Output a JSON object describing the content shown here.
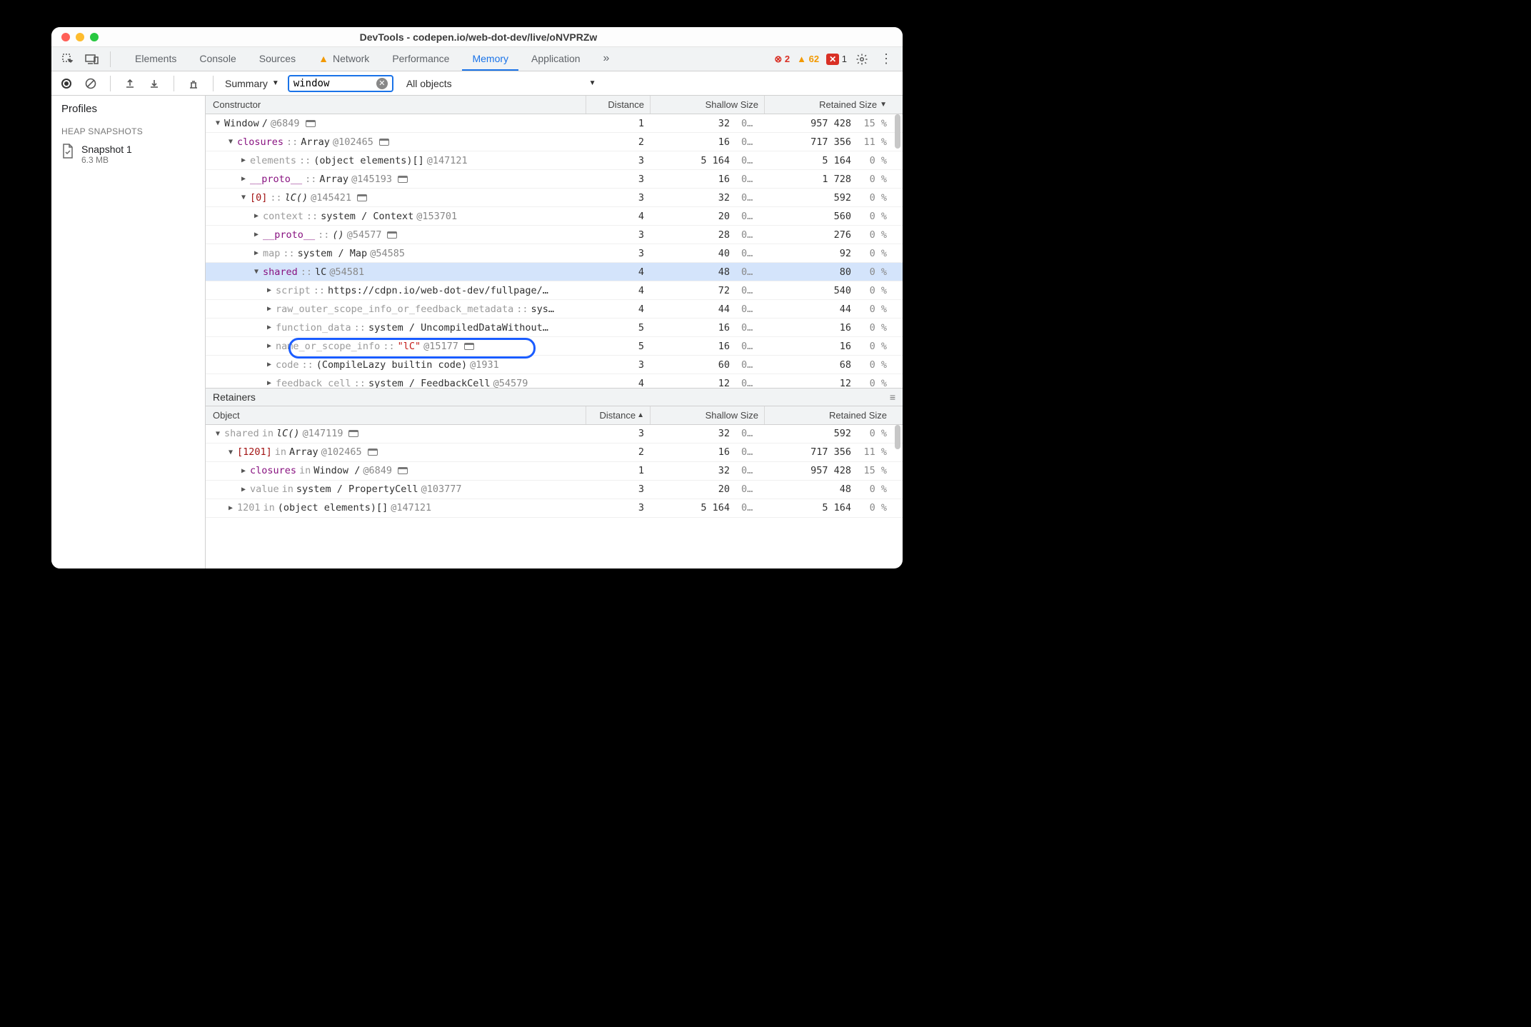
{
  "title": "DevTools - codepen.io/web-dot-dev/live/oNVPRZw",
  "tabs": [
    "Elements",
    "Console",
    "Sources",
    "Network",
    "Performance",
    "Memory",
    "Application"
  ],
  "active_tab": "Memory",
  "overflow_glyph": "»",
  "counters": {
    "errors": 2,
    "warnings": 62,
    "red": 1
  },
  "toolbar": {
    "summary_label": "Summary",
    "filter_value": "window",
    "all_objects_label": "All objects"
  },
  "sidebar": {
    "profiles_label": "Profiles",
    "section_label": "HEAP SNAPSHOTS",
    "snapshot": {
      "name": "Snapshot 1",
      "size": "6.3 MB"
    }
  },
  "headers": {
    "constructor": "Constructor",
    "distance": "Distance",
    "shallow": "Shallow Size",
    "retained": "Retained Size",
    "object": "Object"
  },
  "constructor_rows": [
    {
      "indent": 0,
      "disc": "▼",
      "segments": [
        {
          "t": "Window",
          "c": ""
        },
        {
          "t": " /   ",
          "c": ""
        },
        {
          "t": "@6849",
          "c": "at"
        }
      ],
      "win": true,
      "dist": "1",
      "sh": "32",
      "shp": "0 %",
      "ret": "957 428",
      "retp": "15 %"
    },
    {
      "indent": 1,
      "disc": "▼",
      "segments": [
        {
          "t": "closures",
          "c": "k-purple"
        },
        {
          "t": " :: ",
          "c": "k-grey"
        },
        {
          "t": "Array ",
          "c": ""
        },
        {
          "t": "@102465",
          "c": "at"
        }
      ],
      "win": true,
      "dist": "2",
      "sh": "16",
      "shp": "0 %",
      "ret": "717 356",
      "retp": "11 %"
    },
    {
      "indent": 2,
      "disc": "▶",
      "segments": [
        {
          "t": "elements",
          "c": "k-grey"
        },
        {
          "t": " :: ",
          "c": "k-grey"
        },
        {
          "t": "(object elements)[] ",
          "c": ""
        },
        {
          "t": "@147121",
          "c": "at"
        }
      ],
      "dist": "3",
      "sh": "5 164",
      "shp": "0 %",
      "ret": "5 164",
      "retp": "0 %"
    },
    {
      "indent": 2,
      "disc": "▶",
      "segments": [
        {
          "t": "__proto__",
          "c": "k-purple"
        },
        {
          "t": " :: ",
          "c": "k-grey"
        },
        {
          "t": "Array ",
          "c": ""
        },
        {
          "t": "@145193",
          "c": "at"
        }
      ],
      "win": true,
      "dist": "3",
      "sh": "16",
      "shp": "0 %",
      "ret": "1 728",
      "retp": "0 %"
    },
    {
      "indent": 2,
      "disc": "▼",
      "segments": [
        {
          "t": "[0]",
          "c": "k-darkred"
        },
        {
          "t": " :: ",
          "c": "k-grey"
        },
        {
          "t": "lC() ",
          "c": "italic"
        },
        {
          "t": "@145421",
          "c": "at"
        }
      ],
      "win": true,
      "dist": "3",
      "sh": "32",
      "shp": "0 %",
      "ret": "592",
      "retp": "0 %"
    },
    {
      "indent": 3,
      "disc": "▶",
      "segments": [
        {
          "t": "context",
          "c": "k-grey"
        },
        {
          "t": " :: ",
          "c": "k-grey"
        },
        {
          "t": "system / Context ",
          "c": ""
        },
        {
          "t": "@153701",
          "c": "at"
        }
      ],
      "dist": "4",
      "sh": "20",
      "shp": "0 %",
      "ret": "560",
      "retp": "0 %"
    },
    {
      "indent": 3,
      "disc": "▶",
      "segments": [
        {
          "t": "__proto__",
          "c": "k-purple"
        },
        {
          "t": " :: ",
          "c": "k-grey"
        },
        {
          "t": "() ",
          "c": "italic"
        },
        {
          "t": "@54577",
          "c": "at"
        }
      ],
      "win": true,
      "dist": "3",
      "sh": "28",
      "shp": "0 %",
      "ret": "276",
      "retp": "0 %"
    },
    {
      "indent": 3,
      "disc": "▶",
      "segments": [
        {
          "t": "map",
          "c": "k-grey"
        },
        {
          "t": " :: ",
          "c": "k-grey"
        },
        {
          "t": "system / Map ",
          "c": ""
        },
        {
          "t": "@54585",
          "c": "at"
        }
      ],
      "dist": "3",
      "sh": "40",
      "shp": "0 %",
      "ret": "92",
      "retp": "0 %"
    },
    {
      "indent": 3,
      "disc": "▼",
      "segments": [
        {
          "t": "shared",
          "c": "k-purple"
        },
        {
          "t": " :: ",
          "c": "k-grey"
        },
        {
          "t": "lC ",
          "c": ""
        },
        {
          "t": "@54581",
          "c": "at"
        }
      ],
      "sel": true,
      "dist": "4",
      "sh": "48",
      "shp": "0 %",
      "ret": "80",
      "retp": "0 %"
    },
    {
      "indent": 4,
      "disc": "▶",
      "segments": [
        {
          "t": "script",
          "c": "k-grey"
        },
        {
          "t": " :: ",
          "c": "k-grey"
        },
        {
          "t": "https://cdpn.io/web-dot-dev/fullpage/…",
          "c": ""
        }
      ],
      "dist": "4",
      "sh": "72",
      "shp": "0 %",
      "ret": "540",
      "retp": "0 %"
    },
    {
      "indent": 4,
      "disc": "▶",
      "segments": [
        {
          "t": "raw_outer_scope_info_or_feedback_metadata",
          "c": "k-grey"
        },
        {
          "t": " :: ",
          "c": "k-grey"
        },
        {
          "t": "sys…",
          "c": ""
        }
      ],
      "dist": "4",
      "sh": "44",
      "shp": "0 %",
      "ret": "44",
      "retp": "0 %"
    },
    {
      "indent": 4,
      "disc": "▶",
      "segments": [
        {
          "t": "function_data",
          "c": "k-grey"
        },
        {
          "t": " :: ",
          "c": "k-grey"
        },
        {
          "t": "system / UncompiledDataWithout…",
          "c": ""
        }
      ],
      "dist": "5",
      "sh": "16",
      "shp": "0 %",
      "ret": "16",
      "retp": "0 %"
    },
    {
      "indent": 4,
      "disc": "▶",
      "segments": [
        {
          "t": "name_or_scope_info",
          "c": "k-grey"
        },
        {
          "t": " :: ",
          "c": "k-grey"
        },
        {
          "t": "\"lC\"",
          "c": "k-red"
        },
        {
          "t": " @15177",
          "c": "at"
        }
      ],
      "win": true,
      "ring": true,
      "dist": "5",
      "sh": "16",
      "shp": "0 %",
      "ret": "16",
      "retp": "0 %"
    },
    {
      "indent": 4,
      "disc": "▶",
      "segments": [
        {
          "t": "code",
          "c": "k-grey"
        },
        {
          "t": " :: ",
          "c": "k-grey"
        },
        {
          "t": "(CompileLazy builtin code) ",
          "c": ""
        },
        {
          "t": "@1931",
          "c": "at"
        }
      ],
      "dist": "3",
      "sh": "60",
      "shp": "0 %",
      "ret": "68",
      "retp": "0 %"
    },
    {
      "indent": 4,
      "disc": "▶",
      "segments": [
        {
          "t": "feedback_cell",
          "c": "k-grey"
        },
        {
          "t": " :: ",
          "c": "k-grey"
        },
        {
          "t": "system / FeedbackCell ",
          "c": ""
        },
        {
          "t": "@54579",
          "c": "at"
        }
      ],
      "dist": "4",
      "sh": "12",
      "shp": "0 %",
      "ret": "12",
      "retp": "0 %"
    }
  ],
  "retainers_label": "Retainers",
  "retainer_rows": [
    {
      "indent": 0,
      "disc": "▼",
      "segments": [
        {
          "t": "shared",
          "c": "k-grey"
        },
        {
          "t": " in ",
          "c": "k-grey"
        },
        {
          "t": "lC() ",
          "c": "italic"
        },
        {
          "t": "@147119",
          "c": "at"
        }
      ],
      "win": true,
      "dist": "3",
      "sh": "32",
      "shp": "0 %",
      "ret": "592",
      "retp": "0 %"
    },
    {
      "indent": 1,
      "disc": "▼",
      "segments": [
        {
          "t": "[1201]",
          "c": "k-darkred"
        },
        {
          "t": " in ",
          "c": "k-grey"
        },
        {
          "t": "Array ",
          "c": ""
        },
        {
          "t": "@102465",
          "c": "at"
        }
      ],
      "win": true,
      "dist": "2",
      "sh": "16",
      "shp": "0 %",
      "ret": "717 356",
      "retp": "11 %"
    },
    {
      "indent": 2,
      "disc": "▶",
      "segments": [
        {
          "t": "closures",
          "c": "k-purple"
        },
        {
          "t": " in ",
          "c": "k-grey"
        },
        {
          "t": "Window /   ",
          "c": ""
        },
        {
          "t": "@6849",
          "c": "at"
        }
      ],
      "win": true,
      "dist": "1",
      "sh": "32",
      "shp": "0 %",
      "ret": "957 428",
      "retp": "15 %"
    },
    {
      "indent": 2,
      "disc": "▶",
      "segments": [
        {
          "t": "value",
          "c": "k-grey"
        },
        {
          "t": " in ",
          "c": "k-grey"
        },
        {
          "t": "system / PropertyCell ",
          "c": ""
        },
        {
          "t": "@103777",
          "c": "at"
        }
      ],
      "dist": "3",
      "sh": "20",
      "shp": "0 %",
      "ret": "48",
      "retp": "0 %"
    },
    {
      "indent": 1,
      "disc": "▶",
      "segments": [
        {
          "t": "1201",
          "c": "k-grey"
        },
        {
          "t": " in ",
          "c": "k-grey"
        },
        {
          "t": "(object elements)[] ",
          "c": ""
        },
        {
          "t": "@147121",
          "c": "at"
        }
      ],
      "dist": "3",
      "sh": "5 164",
      "shp": "0 %",
      "ret": "5 164",
      "retp": "0 %"
    }
  ]
}
